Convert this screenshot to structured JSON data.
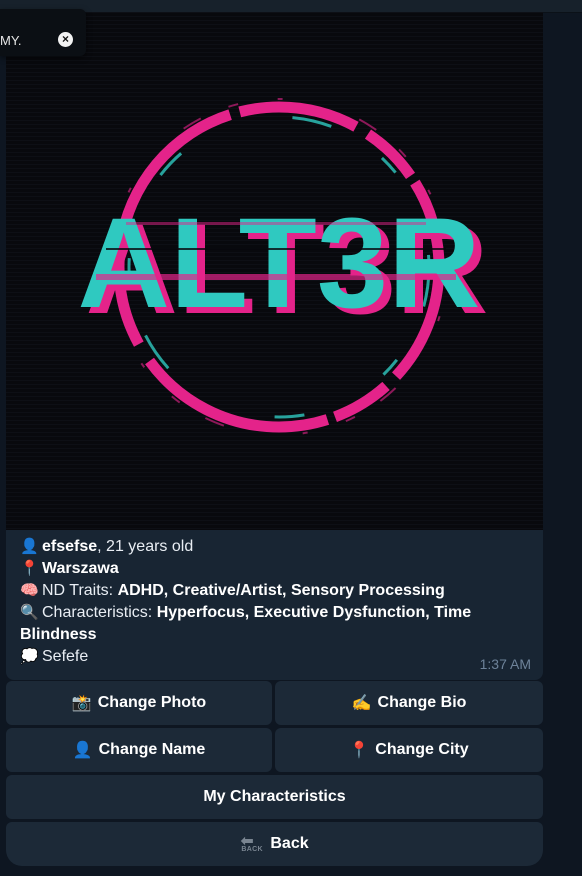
{
  "toast": {
    "text": "MY.",
    "close_icon": "close-icon"
  },
  "profile": {
    "photo": {
      "logo_text": "ALT3R",
      "ring_color": "#e4238a",
      "text_color": "#2fc9c0"
    },
    "name": "efsefse",
    "age_text": ", 21 years old",
    "city": "Warszawa",
    "nd_label": "ND Traits: ",
    "nd_value": "ADHD, Creative/Artist, Sensory Processing",
    "char_label": "Characteristics: ",
    "char_value": "Hyperfocus, Executive Dysfunction, Time Blindness",
    "bio": "Sefefe",
    "time": "1:37 AM",
    "icons": {
      "user": "👤",
      "pin": "📍",
      "brain": "🧠",
      "search": "🔍",
      "thought": "💭"
    }
  },
  "buttons": {
    "change_photo": {
      "icon": "📸",
      "label": "Change Photo"
    },
    "change_bio": {
      "icon": "✍️",
      "label": "Change Bio"
    },
    "change_name": {
      "icon": "👤",
      "label": "Change Name"
    },
    "change_city": {
      "icon": "📍",
      "label": "Change City"
    },
    "my_characteristics": {
      "label": "My Characteristics"
    },
    "back": {
      "icon_text": "BACK",
      "label": "Back"
    }
  }
}
